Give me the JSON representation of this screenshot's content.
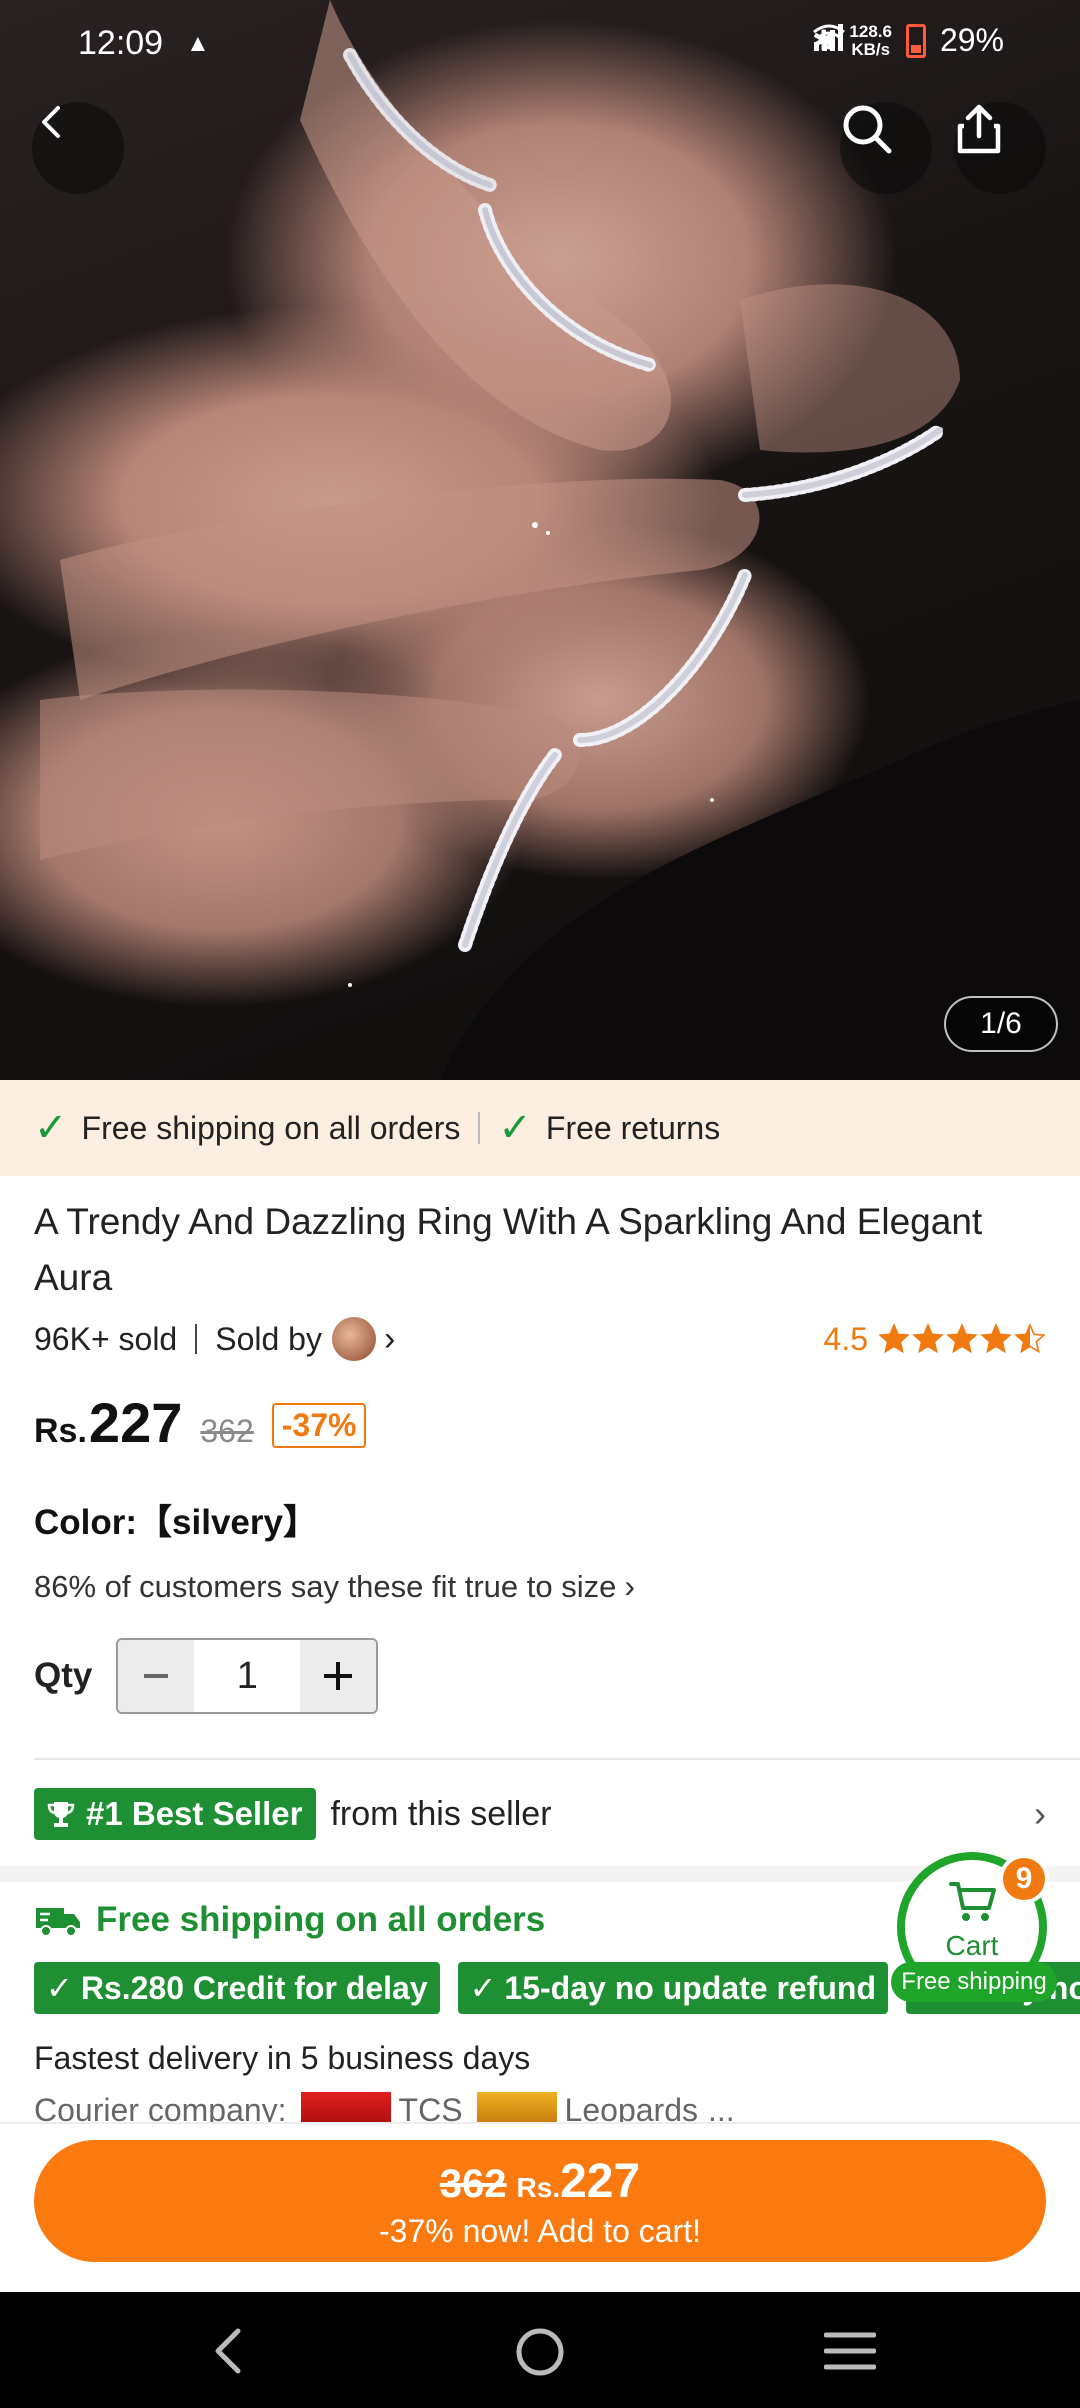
{
  "status_bar": {
    "time": "12:09",
    "net_speed_value": "128.6",
    "net_speed_unit": "KB/s",
    "battery": "29%"
  },
  "hero": {
    "page_indicator": "1/6"
  },
  "banner": {
    "free_shipping": "Free shipping on all orders",
    "free_returns": "Free returns"
  },
  "product": {
    "title": "A Trendy And Dazzling Ring With A Sparkling And Elegant Aura",
    "sold": "96K+ sold",
    "sold_by_label": "Sold by",
    "rating": "4.5",
    "rating_value": 4.5,
    "rating_max": 5,
    "currency": "Rs.",
    "price": "227",
    "old_price": "362",
    "discount": "-37%",
    "color_label": "Color:",
    "color_value": "【silvery】",
    "fit_text": "86% of customers say these fit true to size",
    "qty_label": "Qty",
    "qty_value": "1"
  },
  "seller": {
    "best_badge": "#1 Best Seller",
    "from_text": "from this seller"
  },
  "shipping": {
    "title": "Free shipping on all orders",
    "badges": [
      "Rs.280 Credit for delay",
      "15-day no update refund",
      "Every no"
    ],
    "delivery": "Fastest delivery in 5 business days",
    "courier_label": "Courier company:",
    "courier_1": "TCS",
    "courier_2": "Leopards",
    "courier_more": "..."
  },
  "cart": {
    "label": "Cart",
    "count": "9",
    "free_shipping": "Free shipping"
  },
  "cta": {
    "old_price": "362",
    "currency": "Rs.",
    "price": "227",
    "text": "-37% now! Add to cart!"
  },
  "colors": {
    "accent_orange": "#fa7a0f",
    "green": "#1e8f32",
    "banner_bg": "#fdeee2"
  }
}
